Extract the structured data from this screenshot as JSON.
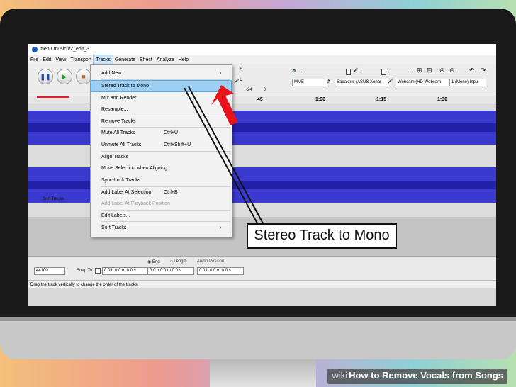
{
  "window": {
    "title": "menu music v2_edit_3"
  },
  "menubar": [
    "File",
    "Edit",
    "View",
    "Transport",
    "Tracks",
    "Generate",
    "Effect",
    "Analyze",
    "Help"
  ],
  "toolbar": {
    "meter_l": "L",
    "meter_r": "R",
    "meter_vals": [
      "-24",
      "0"
    ],
    "host": "MME",
    "speaker": "Speakers (ASUS Xonar",
    "mic": "Webcam (HD Webcam",
    "channels": "1 (Mono) Inpu"
  },
  "ruler": [
    "45",
    "1:00",
    "1:15",
    "1:30"
  ],
  "tracks": {
    "name": "Sort Tracks"
  },
  "tracks_menu": {
    "items": [
      "Add New",
      "Stereo Track to Mono",
      "Mix and Render",
      "Resample...",
      "Remove Tracks",
      "Mute All Tracks",
      "Unmute All Tracks",
      "Align Tracks",
      "Move Selection when Aligning",
      "Sync-Lock Tracks",
      "Add Label At Selection",
      "Add Label At Playback Position",
      "Edit Labels...",
      "Sort Tracks"
    ],
    "shortcuts": {
      "mute": "Ctrl+U",
      "unmute": "Ctrl+Shift+U",
      "label": "Ctrl+B"
    }
  },
  "selection_bar": {
    "rate": "44100",
    "snap_label": "Snap To",
    "end_label": "End",
    "length_label": "Length",
    "audio_position_label": "Audio Position:",
    "time_values": [
      "0 0 h 0 0 m 0 0 s",
      "0 0 h 0 0 m 0 0 s",
      "0 0 h 0 0 m 0 0 s"
    ]
  },
  "status": "Drag the track vertically to change the order of the tracks.",
  "callout": "Stereo Track to Mono",
  "watermark": {
    "wiki": "wiki",
    "how": "How",
    "title": " to Remove Vocals from Songs"
  },
  "colors": {
    "accent_red": "#e8141c",
    "waveform": "#3a3ad0",
    "highlight": "#9ccff2"
  }
}
